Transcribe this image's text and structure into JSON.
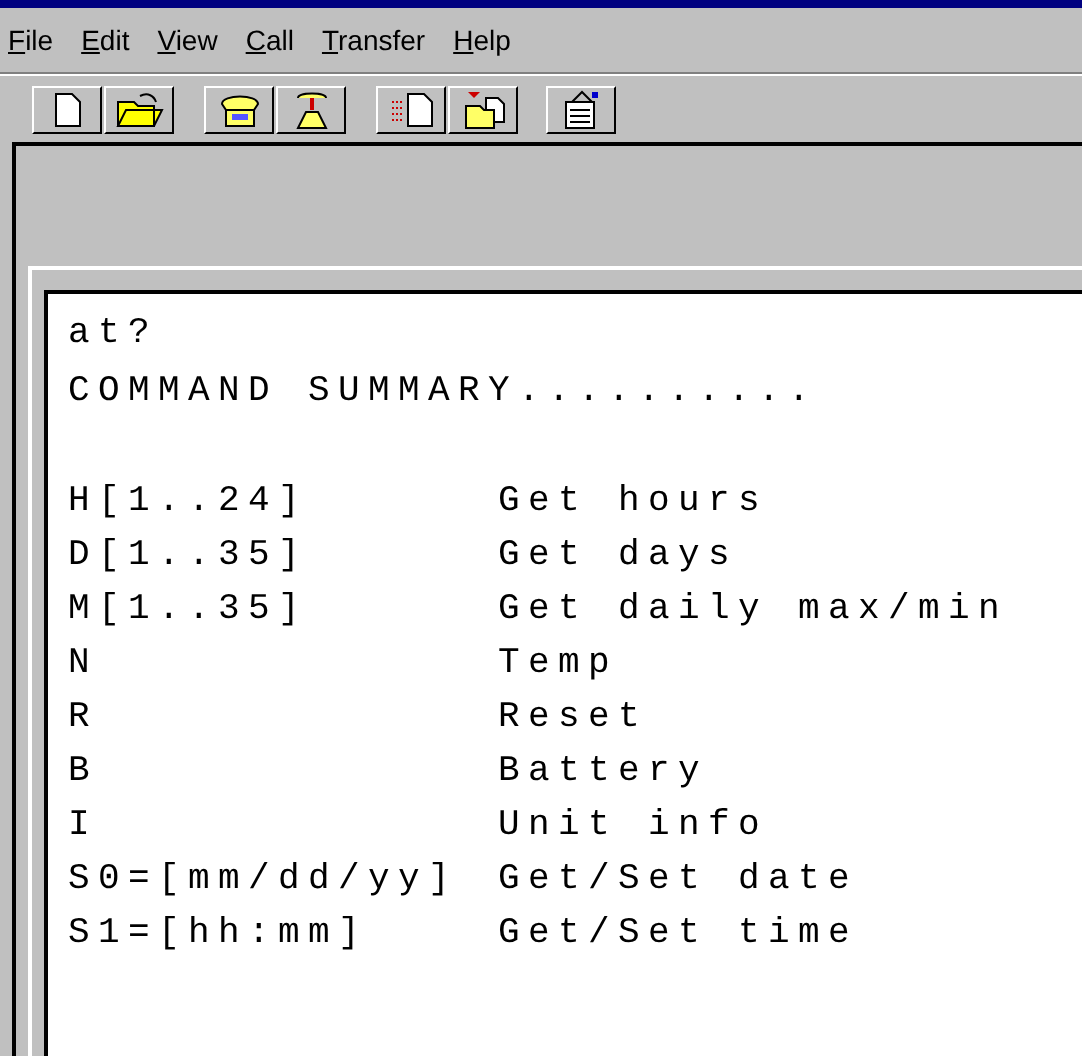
{
  "menu_bar": {
    "items": [
      {
        "label": "File"
      },
      {
        "label": "Edit"
      },
      {
        "label": "View"
      },
      {
        "label": "Call"
      },
      {
        "label": "Transfer"
      },
      {
        "label": "Help"
      }
    ]
  },
  "terminal": {
    "prompt": "at?",
    "heading": "COMMAND SUMMARY..........",
    "commands": [
      {
        "command": "H[1..24]",
        "description": "Get hours"
      },
      {
        "command": "D[1..35]",
        "description": "Get days"
      },
      {
        "command": "M[1..35]",
        "description": "Get daily max/min"
      },
      {
        "command": "N",
        "description": "Temp"
      },
      {
        "command": "R",
        "description": "Reset"
      },
      {
        "command": "B",
        "description": "Battery"
      },
      {
        "command": "I",
        "description": "Unit info"
      },
      {
        "command": "S0=[mm/dd/yy]",
        "description": "Get/Set date"
      },
      {
        "command": "S1=[hh:mm]",
        "description": "Get/Set time"
      }
    ]
  }
}
